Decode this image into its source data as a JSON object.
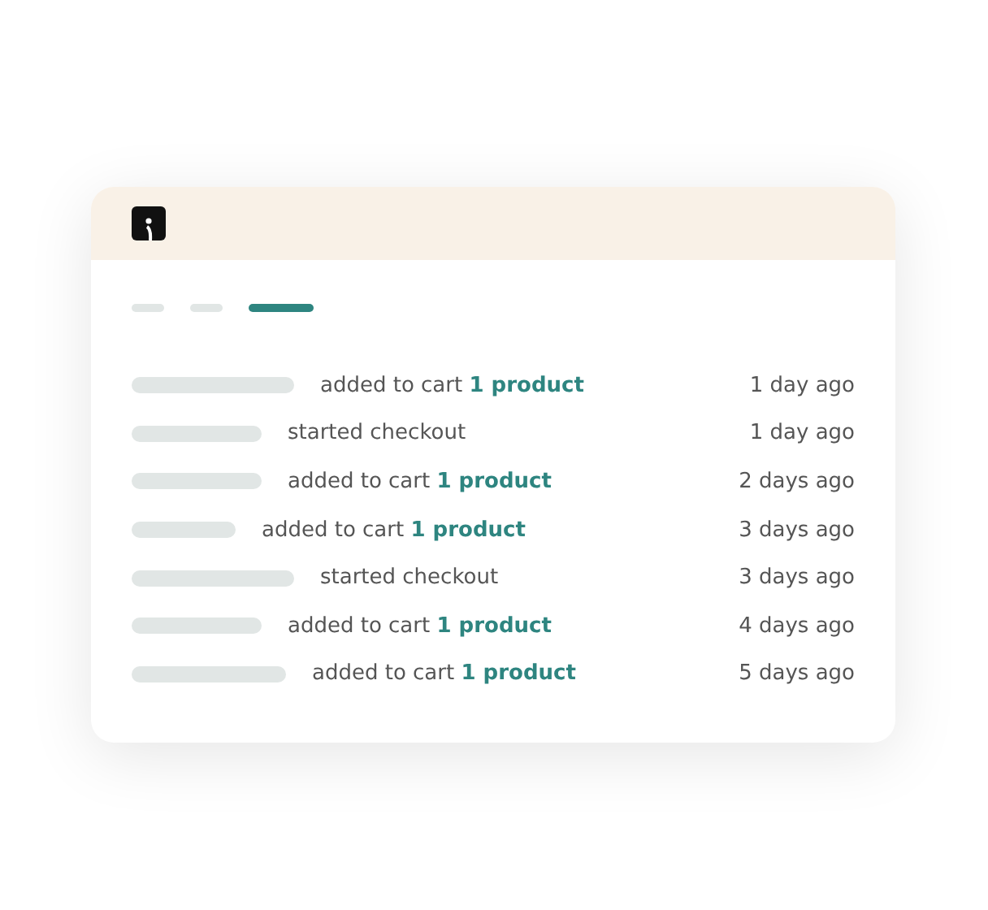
{
  "tabs": [
    {
      "selected": false
    },
    {
      "selected": false
    },
    {
      "selected": true
    }
  ],
  "events": [
    {
      "action": "added to cart **1 product**",
      "time": "1 day ago"
    },
    {
      "action": "started checkout",
      "time": "1 day ago"
    },
    {
      "action": "added to cart **1 product**",
      "time": "2 days ago"
    },
    {
      "action": "added to cart **1 product**",
      "time": "3 days ago"
    },
    {
      "action": "started checkout",
      "time": "3 days ago"
    },
    {
      "action": "added to cart **1 product**",
      "time": "4 days ago"
    },
    {
      "action": "added to cart **1 product**",
      "time": "5 days ago"
    }
  ]
}
